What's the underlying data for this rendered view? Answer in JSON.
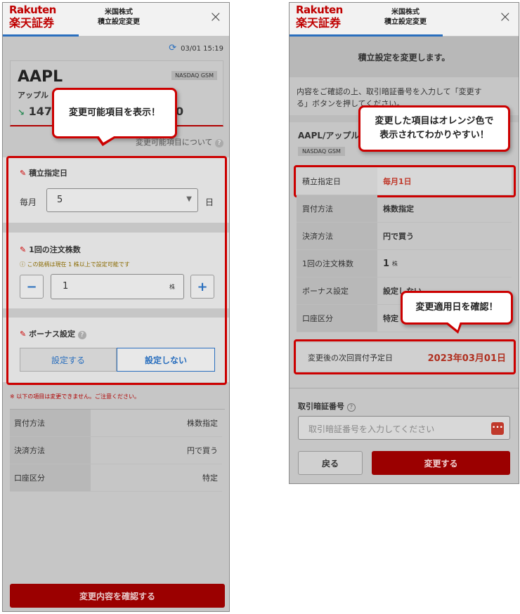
{
  "left": {
    "header": {
      "logo_en": "Rakuten",
      "logo_jp": "楽天証券",
      "title_line1": "米国株式",
      "title_line2": "積立設定変更",
      "close": "×"
    },
    "timestamp": "03/01 15:19",
    "stock": {
      "ticker": "AAPL",
      "exchange": "NASDAQ GSM",
      "name": "アップル",
      "price_partial": "147",
      "price_tail": "0"
    },
    "callout_editable": "変更可能項目を表示！",
    "editable_link": "変更可能項目について",
    "help": "?",
    "day": {
      "label": "積立指定日",
      "prefix": "毎月",
      "value": "5",
      "suffix": "日"
    },
    "shares": {
      "label": "1回の注文株数",
      "note": "この銘柄は現在 1 株以上で設定可能です",
      "value": "1",
      "unit": "株",
      "minus": "−",
      "plus": "+"
    },
    "bonus": {
      "label": "ボーナス設定",
      "opt_on": "設定する",
      "opt_off": "設定しない"
    },
    "warning": "※ 以下の項目は変更できません。ご注意ください。",
    "fixed_rows": [
      {
        "k": "買付方法",
        "v": "株数指定"
      },
      {
        "k": "決済方法",
        "v": "円で買う"
      },
      {
        "k": "口座区分",
        "v": "特定"
      }
    ],
    "confirm_button": "変更内容を確認する"
  },
  "right": {
    "header": {
      "logo_en": "Rakuten",
      "logo_jp": "楽天証券",
      "title_line1": "米国株式",
      "title_line2": "積立設定変更",
      "close": "×"
    },
    "banner": "積立設定を変更します。",
    "intro_line1": "内容をご確認の上、取引暗証番号を入力して「変更す",
    "intro_line2": "る」ボタンを押してください。",
    "callout_orange": "変更した項目はオレンジ色で\n表示されてわかりやすい！",
    "stock_name": "AAPL/アップル",
    "exchange": "NASDAQ GSM",
    "rows": [
      {
        "k": "積立指定日",
        "v": "毎月1日"
      },
      {
        "k": "買付方法",
        "v": "株数指定"
      },
      {
        "k": "決済方法",
        "v": "円で買う"
      },
      {
        "k": "1回の注文株数",
        "v": "1",
        "unit": "株"
      },
      {
        "k": "ボーナス設定",
        "v": "設定しない"
      },
      {
        "k": "口座区分",
        "v": "特定"
      }
    ],
    "callout_date": "変更適用日を確認！",
    "next_date_label": "変更後の次回買付予定日",
    "next_date_value": "2023年03月01日",
    "pin_label": "取引暗証番号",
    "pin_placeholder": "取引暗証番号を入力してください",
    "back_button": "戻る",
    "submit_button": "変更する"
  },
  "colors": {
    "brand": "#bf0000",
    "highlight_red": "#cc0000",
    "orange_text": "#c0392b",
    "link_blue": "#2a6fbe"
  }
}
